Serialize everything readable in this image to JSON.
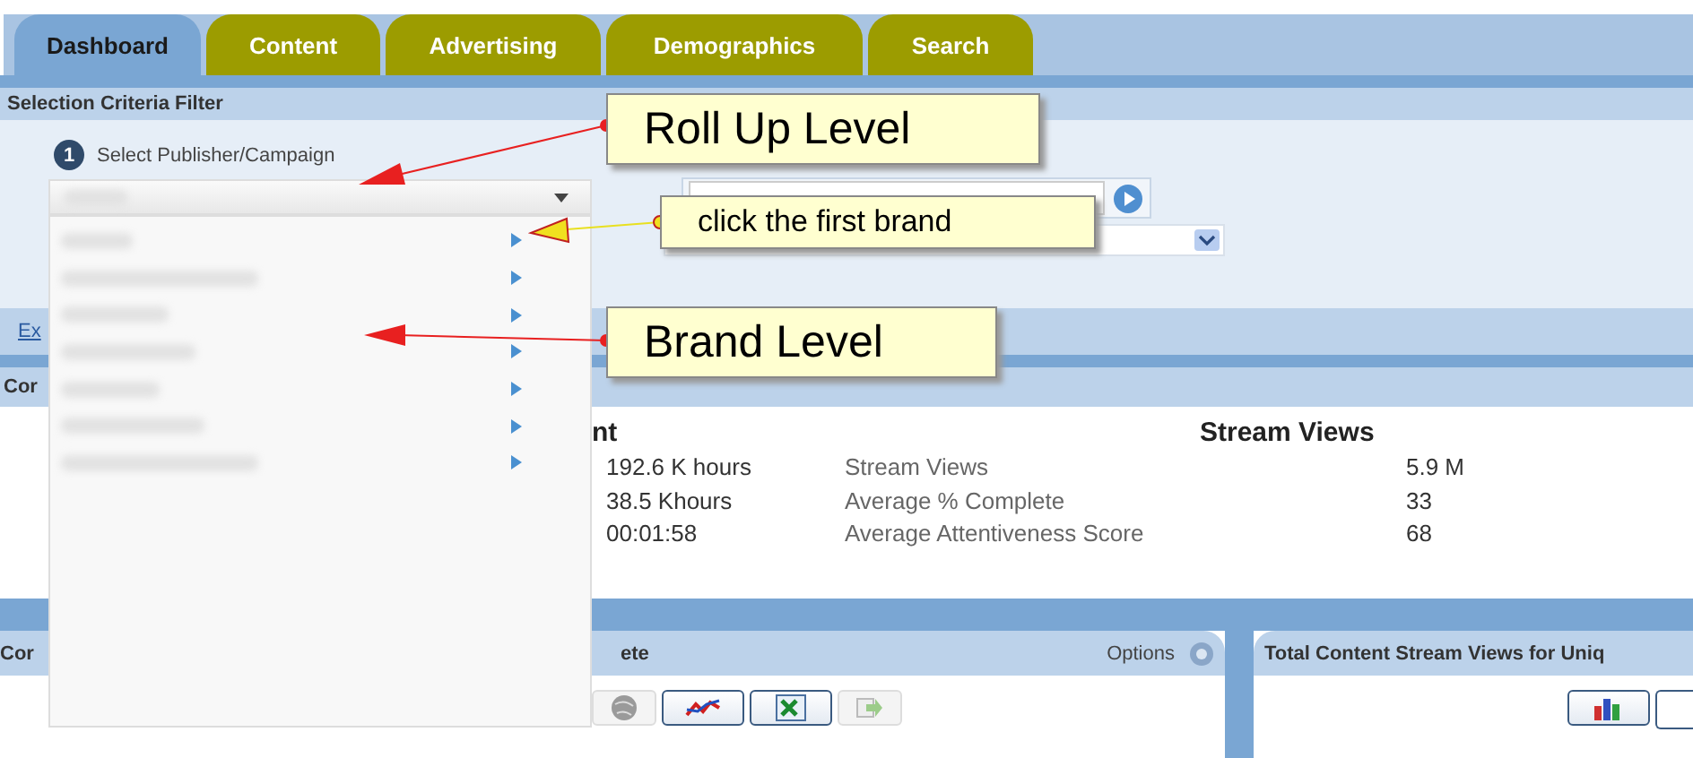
{
  "tabs": [
    {
      "label": "Dashboard",
      "selected": true
    },
    {
      "label": "Content",
      "selected": false
    },
    {
      "label": "Advertising",
      "selected": false
    },
    {
      "label": "Demographics",
      "selected": false
    },
    {
      "label": "Search",
      "selected": false
    }
  ],
  "filter": {
    "title": "Selection Criteria Filter",
    "step_number": "1",
    "step_label": "Select Publisher/Campaign"
  },
  "publisher_menu": {
    "items": [
      {
        "has_submenu": true
      },
      {
        "has_submenu": true
      },
      {
        "has_submenu": true
      },
      {
        "has_submenu": true
      },
      {
        "has_submenu": true
      },
      {
        "has_submenu": true
      },
      {
        "has_submenu": true
      }
    ]
  },
  "link_fragment": "Ex",
  "section_header_fragment": "Cor",
  "summary": {
    "left_header_fragment": "nt",
    "right_header": "Stream Views",
    "rows": [
      {
        "value": "192.6 K hours",
        "metric": "Stream Views",
        "metric_value": "5.9 M"
      },
      {
        "value": "38.5 Khours",
        "metric": "Average % Complete",
        "metric_value": "33"
      },
      {
        "value": "00:01:58",
        "metric": "Average Attentiveness Score",
        "metric_value": "68"
      }
    ]
  },
  "left_panel": {
    "title_fragment_start": "Cor",
    "title_fragment_end": "ete",
    "options_label": "Options",
    "buttons": [
      {
        "kind": "globe",
        "disabled": true
      },
      {
        "kind": "line",
        "disabled": false
      },
      {
        "kind": "excel",
        "disabled": false
      },
      {
        "kind": "export",
        "disabled": true
      }
    ]
  },
  "right_panel": {
    "title": "Total Content Stream Views for Uniq",
    "buttons": [
      {
        "kind": "bar",
        "disabled": false
      }
    ]
  },
  "callouts": [
    {
      "text": "Roll Up Level"
    },
    {
      "text": "click the first brand"
    },
    {
      "text": "Brand Level"
    }
  ]
}
